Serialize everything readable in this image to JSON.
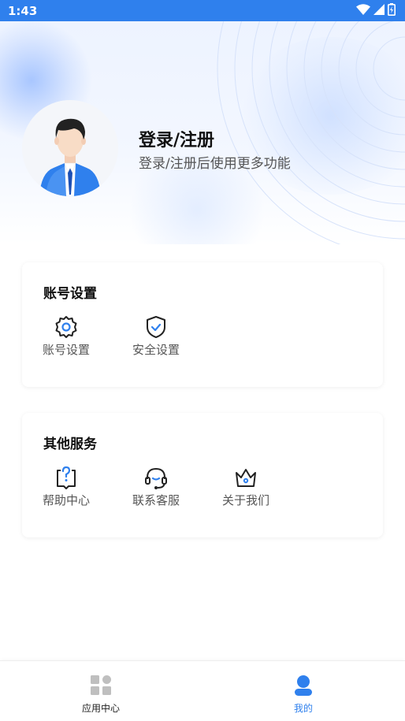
{
  "status_bar": {
    "time": "1:43",
    "icons": [
      "wifi-icon",
      "signal-icon",
      "battery-icon"
    ]
  },
  "profile": {
    "login_title": "登录/注册",
    "login_subtitle": "登录/注册后使用更多功能",
    "avatar": "avatar-icon"
  },
  "account_section": {
    "title": "账号设置",
    "items": [
      {
        "label": "账号设置",
        "icon": "gear-icon"
      },
      {
        "label": "安全设置",
        "icon": "shield-check-icon"
      }
    ]
  },
  "other_section": {
    "title": "其他服务",
    "items": [
      {
        "label": "帮助中心",
        "icon": "help-question-icon"
      },
      {
        "label": "联系客服",
        "icon": "headset-icon"
      },
      {
        "label": "关于我们",
        "icon": "crown-icon"
      }
    ]
  },
  "tabbar": {
    "tabs": [
      {
        "label": "应用中心",
        "icon": "grid-apps-icon",
        "active": false
      },
      {
        "label": "我的",
        "icon": "user-icon",
        "active": true
      }
    ]
  },
  "colors": {
    "accent": "#2f80ed",
    "icon_dark": "#222222",
    "tab_inactive_icon": "#bfbfbf"
  }
}
